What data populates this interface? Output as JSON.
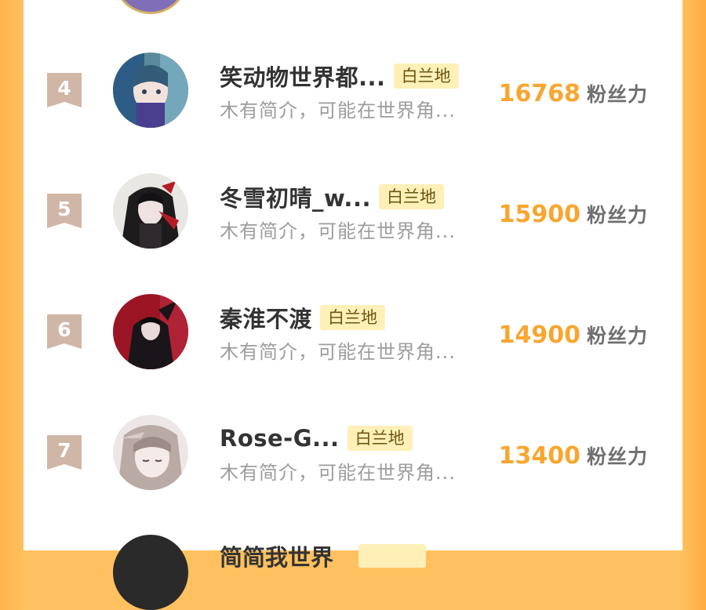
{
  "colors": {
    "accent": "#f8a630",
    "tag_bg": "#fff0b8",
    "rank_badge": "#cfb6a6",
    "frame": "#ffc15f"
  },
  "ranking": [
    {
      "rank": "4",
      "name": "笑动物世界都...",
      "tag": "白兰地",
      "description": "木有简介，可能在世界角...",
      "score": "16768",
      "unit": "粉丝力",
      "avatar_icon": "avatar-girl-blue-hair-icon"
    },
    {
      "rank": "5",
      "name": "冬雪初晴_w...",
      "tag": "白兰地",
      "description": "木有简介，可能在世界角...",
      "score": "15900",
      "unit": "粉丝力",
      "avatar_icon": "avatar-dark-hair-red-ribbon-icon"
    },
    {
      "rank": "6",
      "name": "秦淮不渡",
      "tag": "白兰地",
      "description": "木有简介，可能在世界角...",
      "score": "14900",
      "unit": "粉丝力",
      "avatar_icon": "avatar-red-background-icon"
    },
    {
      "rank": "7",
      "name": "Rose-G...",
      "tag": "白兰地",
      "description": "木有简介，可能在世界角...",
      "score": "13400",
      "unit": "粉丝力",
      "avatar_icon": "avatar-sleeping-girl-icon"
    }
  ],
  "partial_bottom": {
    "name": "简简我世界"
  }
}
